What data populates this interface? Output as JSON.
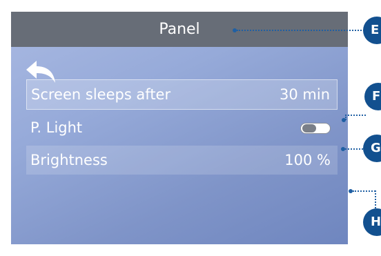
{
  "header": {
    "title": "Panel"
  },
  "back": {
    "icon": "back-arrow-icon"
  },
  "settings": [
    {
      "label": "Screen sleeps after",
      "value": "30 min"
    },
    {
      "label": "P. Light",
      "toggle_state": "off"
    },
    {
      "label": "Brightness",
      "value": "100 %"
    }
  ],
  "callouts": [
    "E",
    "F",
    "G",
    "H"
  ],
  "colors": {
    "titlebar": "#676d77",
    "screen_gradient_start": "#a9b9e2",
    "screen_gradient_end": "#6f86bf",
    "callout": "#12508f"
  }
}
